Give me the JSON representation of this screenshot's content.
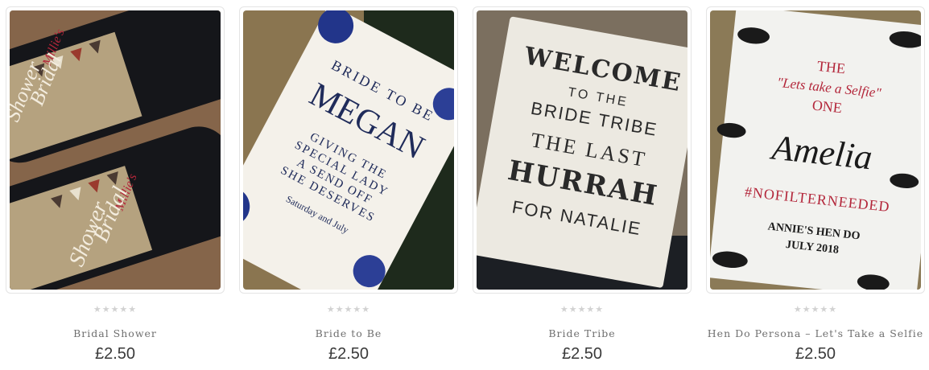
{
  "products": [
    {
      "name": "Bridal Shower",
      "price": "£2.50",
      "rating_stars": 0,
      "rating_max": 5,
      "image": {
        "kind": "wine bottle labels",
        "label_text_1": "Millie's",
        "label_text_2": "Bridal",
        "label_text_3": "Shower"
      }
    },
    {
      "name": "Bride to Be",
      "price": "£2.50",
      "rating_stars": 0,
      "rating_max": 5,
      "image": {
        "kind": "wine bottle label",
        "label_text_1": "BRIDE TO BE",
        "label_text_2": "MEGAN",
        "label_text_3": "GIVING THE",
        "label_text_4": "SPECIAL LADY",
        "label_text_5": "A SEND OFF",
        "label_text_6": "SHE DESERVES",
        "label_text_7": "Saturday and July"
      }
    },
    {
      "name": "Bride Tribe",
      "price": "£2.50",
      "rating_stars": 0,
      "rating_max": 5,
      "image": {
        "kind": "wine bottle label",
        "label_text_1": "WELCOME",
        "label_text_2": "TO THE",
        "label_text_3": "BRIDE TRIBE",
        "label_text_4": "THE LAST",
        "label_text_5": "HURRAH",
        "label_text_6": "FOR NATALIE"
      }
    },
    {
      "name": "Hen Do Persona – Let's Take a Selfie",
      "price": "£2.50",
      "rating_stars": 0,
      "rating_max": 5,
      "image": {
        "kind": "wine bottle label",
        "label_text_1": "THE",
        "label_text_2": "\"Lets take a Selfie\"",
        "label_text_3": "ONE",
        "label_text_4": "Amelia",
        "label_text_5": "#NOFILTERNEEDED",
        "label_text_6": "ANNIE'S HEN DO",
        "label_text_7": "JULY 2018"
      }
    }
  ],
  "star_glyph": "★★★★★",
  "colors": {
    "star_empty": "#d2d2d2",
    "title": "#6f6f6f",
    "price": "#3a3a3a",
    "burlap": "#8a7550",
    "label_cream": "#f4f1ea",
    "navy": "#1f2b5a",
    "crimson": "#b3263a",
    "kraft": "#b5a27f"
  }
}
